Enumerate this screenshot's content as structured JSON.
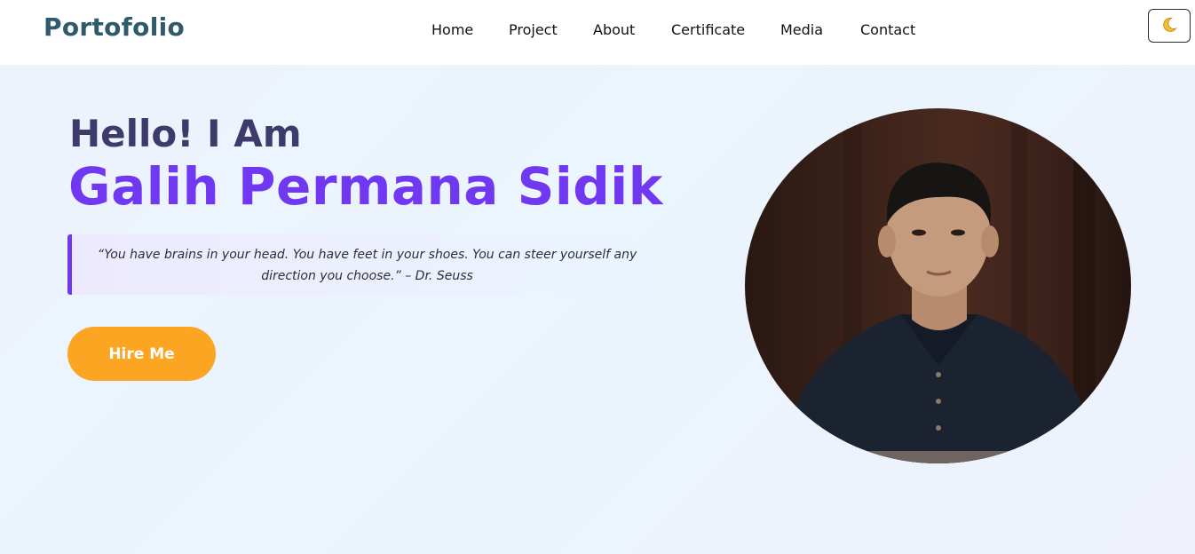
{
  "navbar": {
    "brand": "Portofolio",
    "links": [
      "Home",
      "Project",
      "About",
      "Certificate",
      "Media",
      "Contact"
    ],
    "theme_toggle_icon": "moon-icon"
  },
  "hero": {
    "greeting": "Hello! I Am",
    "name": "Galih Permana Sidik",
    "quote": "“You have brains in your head. You have feet in your shoes. You can steer yourself any direction you choose.” – Dr. Seuss",
    "cta_label": "Hire Me"
  },
  "colors": {
    "accent": "#7038f0",
    "cta": "#fca523",
    "brand": "#2f5a6c"
  }
}
